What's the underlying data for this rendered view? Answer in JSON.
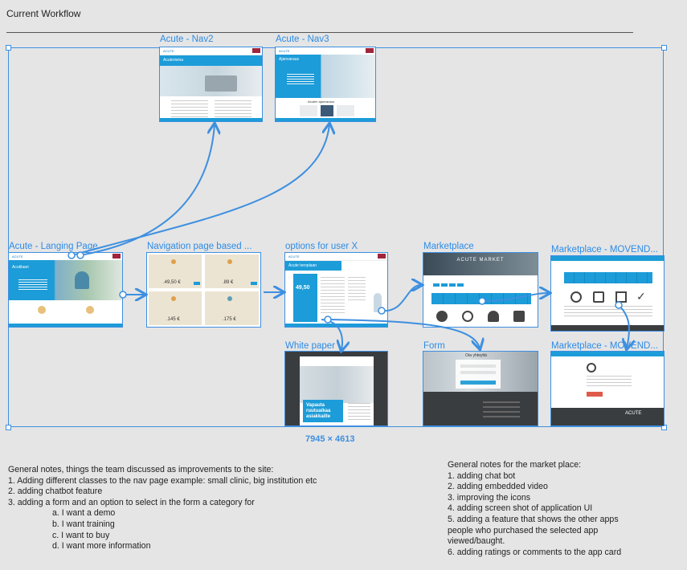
{
  "page": {
    "title": "Current Workflow",
    "dimensions": "7945 × 4613"
  },
  "frames": {
    "nav2": {
      "label": "Acute - Nav2",
      "brand": "ACUTE",
      "hero": "Acuterisma"
    },
    "nav3": {
      "label": "Acute - Nav3",
      "brand": "ACUTE",
      "hero": "Ajanvaraus",
      "sub": "Acuten ajanvaraus"
    },
    "landing": {
      "label": "Acute - Langing Page",
      "brand": "ACUTE",
      "hero": "Acutilaari"
    },
    "navpage": {
      "label": "Navigation page based ...",
      "prices": [
        ".49,50 €",
        ".89 €",
        ".145 €",
        ".175 €"
      ]
    },
    "options": {
      "label": "options for user X",
      "brand": "ACUTE",
      "hero": "Acute teroplaan",
      "price": "49,50"
    },
    "marketplace": {
      "label": "Marketplace",
      "hero": "ACUTE MARKET"
    },
    "marketplace_moveend1": {
      "label": "Marketplace - MOVEND..."
    },
    "whitepaper": {
      "label": "White paper",
      "hero": "Vapauta ruutuaikaa asiakkaille"
    },
    "form": {
      "label": "Form",
      "hero": "Ota yhteyttä"
    },
    "marketplace_moveend2": {
      "label": "Marketplace - MOVEND...",
      "brand": "ACUTE"
    }
  },
  "notes_site": {
    "heading": "General notes, things the team discussed as improvements to the site:",
    "items": [
      "1. Adding different classes to the nav page example: small clinic, big institution etc",
      "2. adding chatbot feature",
      "3. adding a form and an option to select in the form a category for"
    ],
    "subitems": [
      "a. I want a demo",
      "b. I want training",
      "c. I want to buy",
      "d. I want more information"
    ]
  },
  "notes_market": {
    "heading": "General notes for the market place:",
    "items": [
      "1. adding chat bot",
      "2. adding embedded video",
      "3. improving the icons",
      "4. adding screen shot of application UI",
      "5. adding a feature that shows the other apps people who purchased the selected app viewed/baught.",
      "6. adding ratings or comments to the app card"
    ]
  },
  "colors": {
    "accent": "#3d8fe0",
    "brand_blue": "#1c9cd8",
    "brand_red": "#a0243c",
    "background": "#e5e5e5"
  }
}
